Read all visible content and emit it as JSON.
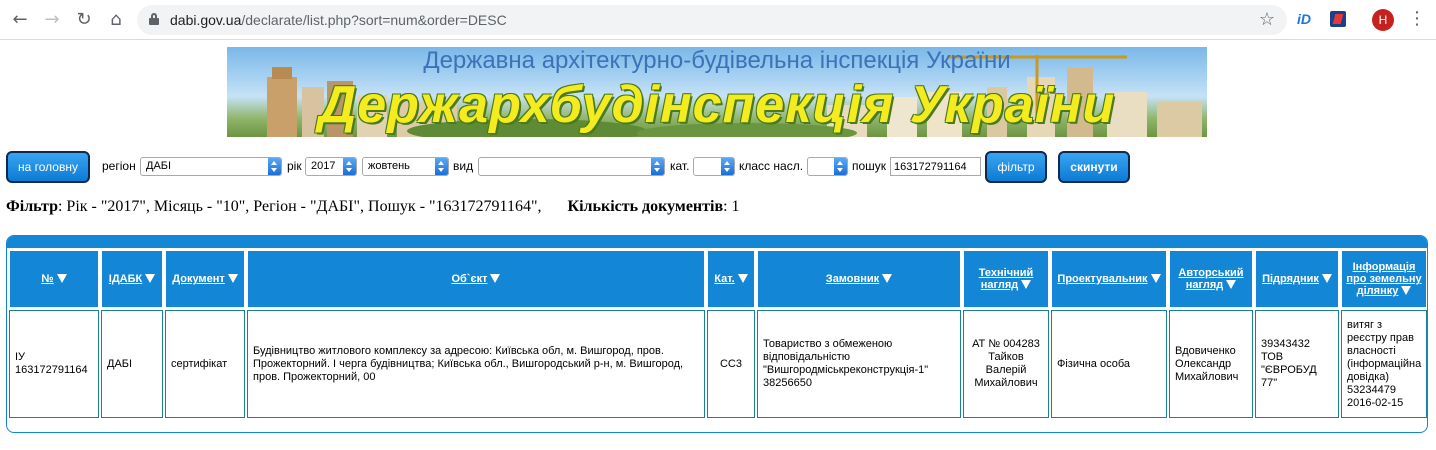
{
  "browser": {
    "url_domain": "dabi.gov.ua",
    "url_path": "/declarate/list.php?sort=num&order=DESC",
    "avatar_initial": "H",
    "extension_label": "iD"
  },
  "banner": {
    "subtitle": "Державна архітектурно-будівельна інспекція України",
    "title": "Держархбудінспекція України"
  },
  "filter_bar": {
    "home_button": "на головну",
    "region_label": "регіон",
    "region_value": "ДАБІ",
    "year_label": "рік",
    "year_value": "2017",
    "month_value": "жовтень",
    "type_label": "вид",
    "type_value": "",
    "cat_label": "кат.",
    "cat_value": "",
    "class_label": "класс насл.",
    "class_value": "",
    "search_label": "пошук",
    "search_value": "163172791164",
    "filter_button": "фільтр",
    "reset_button": "скинути"
  },
  "summary": {
    "filter_label": "Фільтр",
    "filter_text": ": Рік - \"2017\", Місяць - \"10\", Регіон - \"ДАБІ\", Пошук - \"163172791164\",",
    "count_label": "Кількість документів",
    "count_value": ": 1"
  },
  "table": {
    "headers": [
      "№",
      "ІДАБК",
      "Документ",
      "Об`єкт",
      "Кат.",
      "Замовник",
      "Технічний нагляд",
      "Проектувальник",
      "Авторський нагляд",
      "Підрядник",
      "Інформація про земельну ділянку"
    ],
    "row": {
      "num": "ІУ 163172791164",
      "idabk": "ДАБІ",
      "document": "сертифікат",
      "object": "Будівництво житлового комплексу за адресою: Київська обл, м. Вишгород, пров. Прожекторний. І черга будівництва; Київська обл., Вишгородський р-н, м. Вишгород, пров. Прожекторний, 00",
      "cat": "СС3",
      "customer": "Товариство з обмеженою відповідальністю \"Вишгородміськреконструкція-1\" 38256650",
      "tech_supervision": "АТ № 004283 Тайков Валерій Михайлович",
      "designer": "Фізична особа",
      "author_supervision": "Вдовиченко Олександр Михайлович",
      "contractor": "39343432 ТОВ \"ЄВРОБУД 77\"",
      "land_info": "витяг з реєстру прав власності (інформаційна довідка) 53234479 2016-02-15"
    }
  },
  "colors": {
    "header_blue": "#1486d6",
    "button_blue": "#0b7bd6",
    "banner_title": "#f4ec1e",
    "banner_subtitle": "#3b73b8"
  }
}
